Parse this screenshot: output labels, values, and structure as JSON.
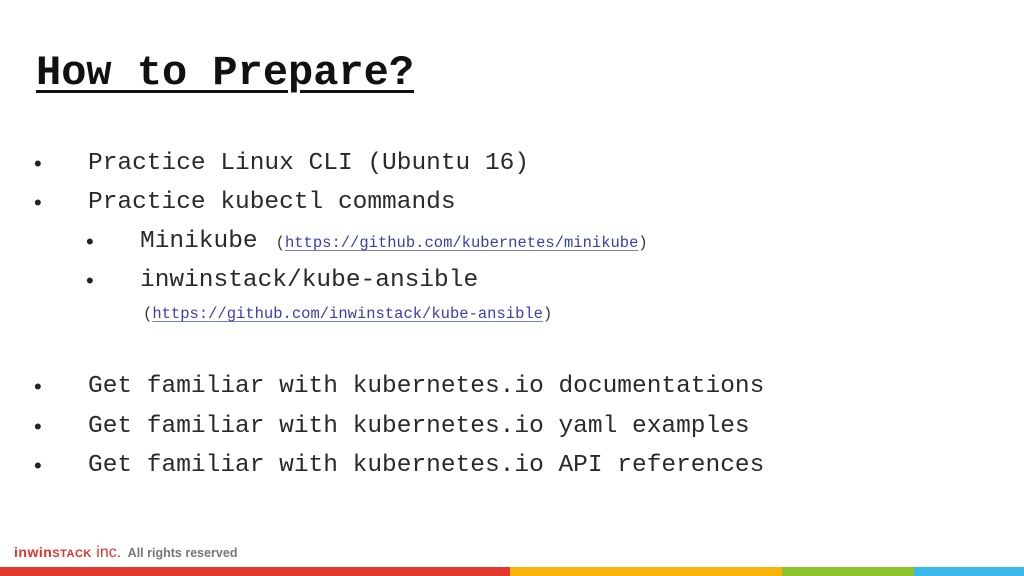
{
  "slide": {
    "title": "How to Prepare?",
    "bullets": [
      {
        "text": "Practice Linux CLI (Ubuntu 16)"
      },
      {
        "text": "Practice kubectl commands"
      },
      {
        "text": "Get familiar with kubernetes.io documentations"
      },
      {
        "text": "Get familiar with kubernetes.io yaml examples"
      },
      {
        "text": "Get familiar with kubernetes.io API references"
      }
    ],
    "sub_bullets": [
      {
        "text": "Minikube",
        "open": "(",
        "link": "https://github.com/kubernetes/minikube",
        "close": ")"
      },
      {
        "text": "inwinstack/kube-ansible",
        "open": "(",
        "link": "https://github.com/inwinstack/kube-ansible",
        "close": ")"
      }
    ],
    "bullet_glyph": "•"
  },
  "footer": {
    "logo_inwin": "inwin",
    "logo_stack": "STACK",
    "logo_inc": " inc.",
    "rights": "  All rights reserved",
    "bar_colors": [
      "#e2382b",
      "#f9b40a",
      "#8cc32a",
      "#3ab9e9"
    ]
  }
}
